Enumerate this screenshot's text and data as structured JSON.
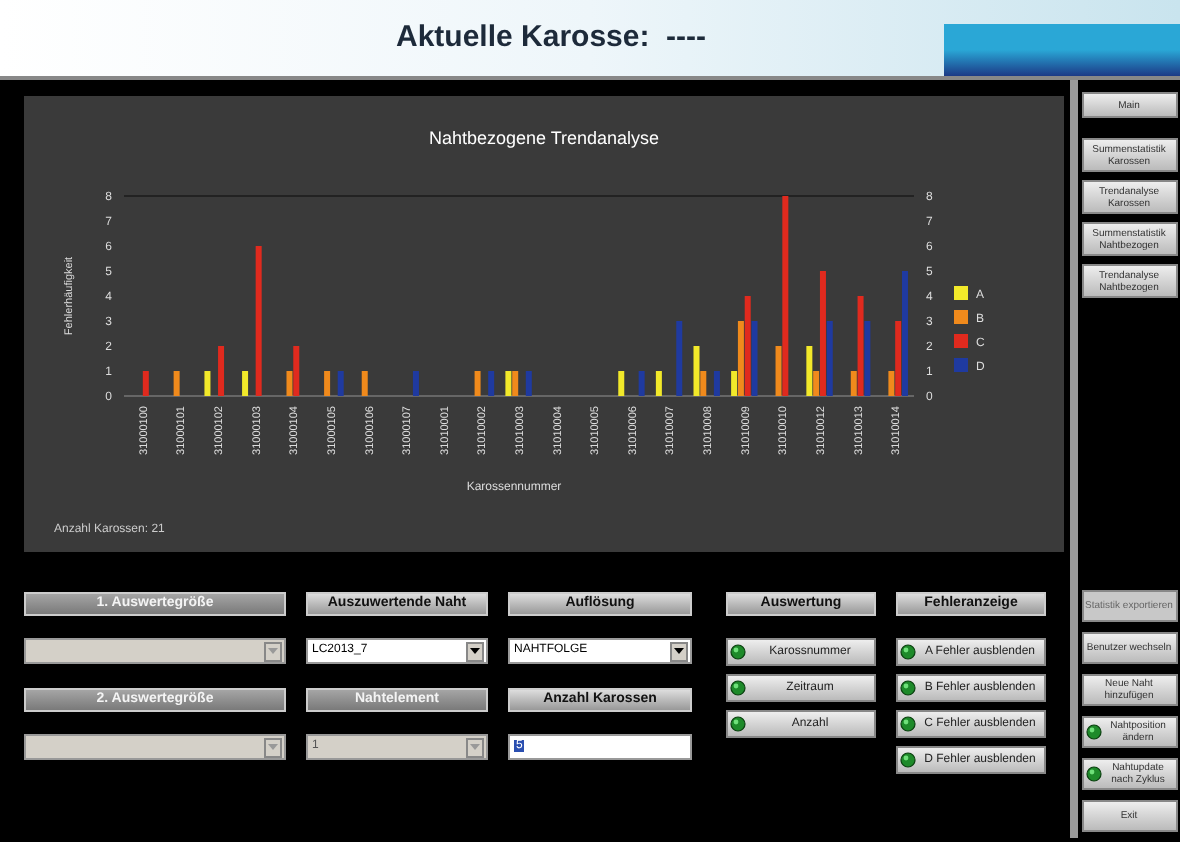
{
  "header": {
    "title": "Aktuelle Karosse:  ----"
  },
  "chart_panel": {
    "chart_data": {
      "type": "bar",
      "title": "Nahtbezogene Trendanalyse",
      "xlabel": "Karossennummer",
      "ylabel": "Fehlerhäufigkeit",
      "categories": [
        "31000100",
        "31000101",
        "31000102",
        "31000103",
        "31000104",
        "31000105",
        "31000106",
        "31000107",
        "31010001",
        "31010002",
        "31010003",
        "31010004",
        "31010005",
        "31010006",
        "31010007",
        "31010008",
        "31010009",
        "31010010",
        "31010012",
        "31010013",
        "31010014"
      ],
      "series": [
        {
          "name": "A",
          "color": "#f2e92a",
          "values": [
            0,
            0,
            1,
            1,
            0,
            0,
            0,
            0,
            0,
            0,
            1,
            0,
            0,
            1,
            1,
            2,
            1,
            0,
            2,
            0,
            0
          ]
        },
        {
          "name": "B",
          "color": "#f08a1c",
          "values": [
            0,
            1,
            0,
            0,
            1,
            1,
            1,
            0,
            0,
            1,
            1,
            0,
            0,
            0,
            0,
            1,
            3,
            2,
            1,
            1,
            1
          ]
        },
        {
          "name": "C",
          "color": "#e02a1e",
          "values": [
            1,
            0,
            2,
            6,
            2,
            0,
            0,
            0,
            0,
            0,
            0,
            0,
            0,
            0,
            0,
            0,
            4,
            8,
            5,
            4,
            3
          ]
        },
        {
          "name": "D",
          "color": "#1f3aa0",
          "values": [
            0,
            0,
            0,
            0,
            0,
            1,
            0,
            1,
            0,
            1,
            1,
            0,
            0,
            1,
            3,
            1,
            3,
            0,
            3,
            3,
            5
          ]
        }
      ],
      "ylim": [
        0,
        8
      ],
      "yticks": [
        0,
        1,
        2,
        3,
        4,
        5,
        6,
        7,
        8
      ],
      "legend": "right"
    },
    "left_axis_ticks": [
      "8",
      "7",
      "6",
      "5",
      "4",
      "3",
      "2",
      "1",
      "0"
    ],
    "footer": "Anzahl Karossen: 21"
  },
  "controls": [
    {
      "kind": "select",
      "header": "1. Auswertegröße",
      "disabled": true
    },
    {
      "kind": "select",
      "header": "Auszuwertende Naht",
      "disabled": false,
      "value": "LC2013_7"
    },
    {
      "kind": "select",
      "header": "Auflösung",
      "disabled": false,
      "value": "NAHTFOLGE"
    },
    {
      "kind": "select",
      "header": "2. Auswertegröße",
      "disabled": true
    },
    {
      "kind": "select",
      "header": "Nahtelement",
      "disabled": true,
      "value": "1"
    },
    {
      "kind": "input",
      "header": "Anzahl Karossen",
      "disabled": false,
      "value": "5"
    }
  ],
  "auswertung": {
    "header": "Auswertung",
    "buttons": [
      {
        "label": "Karossnummer",
        "on": true
      },
      {
        "label": "Zeitraum",
        "on": true
      },
      {
        "label": "Anzahl",
        "on": true
      }
    ]
  },
  "fehleranzeige": {
    "header": "Fehleranzeige",
    "buttons": [
      {
        "label": "A Fehler ausblenden",
        "on": true
      },
      {
        "label": "B Fehler ausblenden",
        "on": true
      },
      {
        "label": "C Fehler ausblenden",
        "on": true
      },
      {
        "label": "D Fehler ausblenden",
        "on": true
      }
    ]
  },
  "sidebar": {
    "top": [
      {
        "label": "Main"
      },
      {
        "label": "Summenstatistik Karossen"
      },
      {
        "label": "Trendanalyse Karossen"
      },
      {
        "label": "Summenstatistik Nahtbezogen"
      },
      {
        "label": "Trendanalyse Nahtbezogen"
      }
    ],
    "bottom": [
      {
        "label": "Statistik exportieren",
        "disabled": true,
        "led": false
      },
      {
        "label": "Benutzer wechseln",
        "disabled": false,
        "led": false
      },
      {
        "label": "Neue Naht hinzufügen",
        "disabled": false,
        "led": false
      },
      {
        "label": "Nahtposition ändern",
        "disabled": false,
        "led": true
      },
      {
        "label": "Nahtupdate nach Zyklus",
        "disabled": false,
        "led": true
      },
      {
        "label": "Exit",
        "disabled": false,
        "led": false
      }
    ]
  }
}
